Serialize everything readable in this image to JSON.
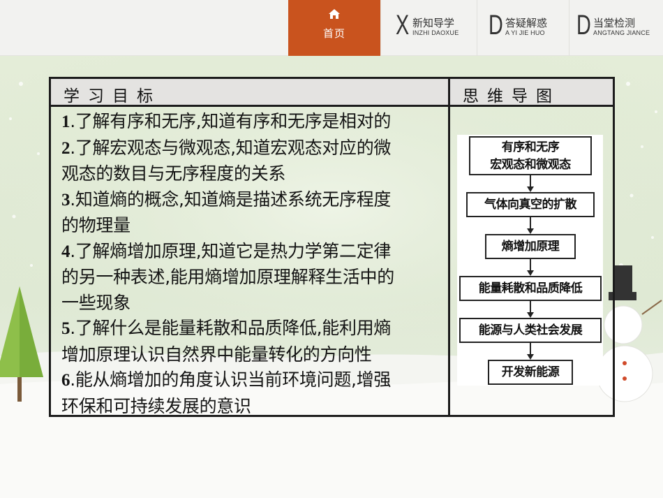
{
  "nav": {
    "home_label": "首页",
    "tabs": [
      {
        "letter": "X",
        "label": "新知导学",
        "sub": "INZHI DAOXUE"
      },
      {
        "letter": "D",
        "label": "答疑解惑",
        "sub": "A YI JIE HUO"
      },
      {
        "letter": "D",
        "label": "当堂检测",
        "sub": "ANGTANG JIANCE"
      }
    ]
  },
  "table": {
    "left_header": "学习目标",
    "right_header": "思维导图",
    "goals": [
      {
        "num": "1",
        "lines": [
          ".了解有序和无序,知道有序和无序是相对的"
        ]
      },
      {
        "num": "2",
        "lines": [
          ".了解宏观态与微观态,知道宏观态对应的微",
          "观态的数目与无序程度的关系"
        ]
      },
      {
        "num": "3",
        "lines": [
          ".知道熵的概念,知道熵是描述系统无序程度",
          "的物理量"
        ]
      },
      {
        "num": "4",
        "lines": [
          ".了解熵增加原理,知道它是热力学第二定律",
          "的另一种表述,能用熵增加原理解释生活中的",
          "一些现象"
        ]
      },
      {
        "num": "5",
        "lines": [
          ".了解什么是能量耗散和品质降低,能利用熵",
          "增加原理认识自然界中能量转化的方向性"
        ]
      },
      {
        "num": "6",
        "lines": [
          ".能从熵增加的角度认识当前环境问题,增强",
          "环保和可持续发展的意识"
        ]
      }
    ]
  },
  "mindmap": {
    "nodes": [
      {
        "lines": [
          "有序和无序",
          "宏观态和微观态"
        ]
      },
      {
        "lines": [
          "气体向真空的扩散"
        ]
      },
      {
        "lines": [
          "熵增加原理"
        ]
      },
      {
        "lines": [
          "能量耗散和品质降低"
        ]
      },
      {
        "lines": [
          "能源与人类社会发展"
        ]
      },
      {
        "lines": [
          "开发新能源"
        ]
      }
    ]
  },
  "colors": {
    "home_accent": "#c9531e",
    "header_fill": "#e4e3e1",
    "background": "#e6efd9"
  },
  "icons": {
    "home": "home-icon"
  }
}
